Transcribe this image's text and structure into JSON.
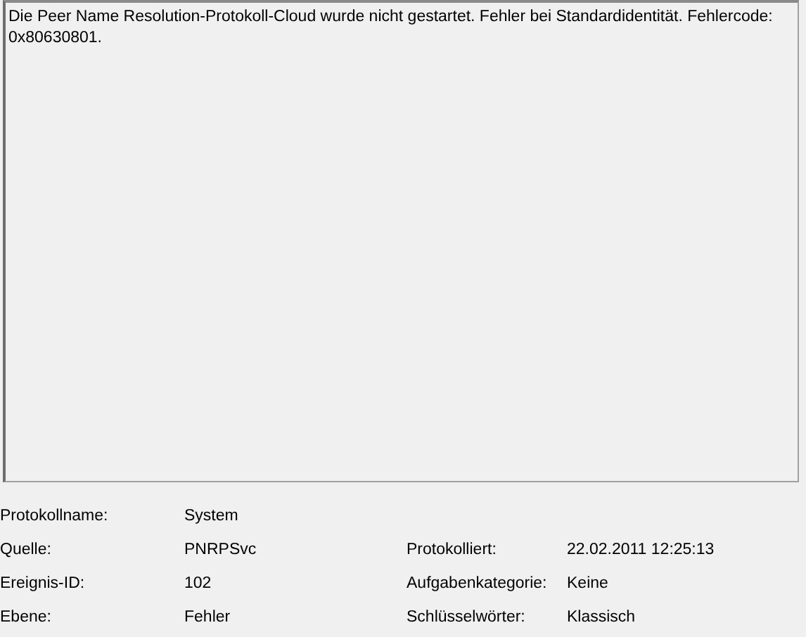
{
  "description": "Die Peer Name Resolution-Protokoll-Cloud wurde nicht gestartet. Fehler bei Standardidentität. Fehlercode: 0x80630801.",
  "fields": [
    {
      "label": "Protokollname:",
      "value": "System"
    },
    {
      "label": "Quelle:",
      "value": "PNRPSvc",
      "label_2": "Protokolliert:",
      "value_2": "22.02.2011 12:25:13"
    },
    {
      "label": "Ereignis-ID:",
      "value": "102",
      "label_2": "Aufgabenkategorie:",
      "value_2": "Keine"
    },
    {
      "label": "Ebene:",
      "value": "Fehler",
      "label_2": "Schlüsselwörter:",
      "value_2": "Klassisch"
    }
  ]
}
